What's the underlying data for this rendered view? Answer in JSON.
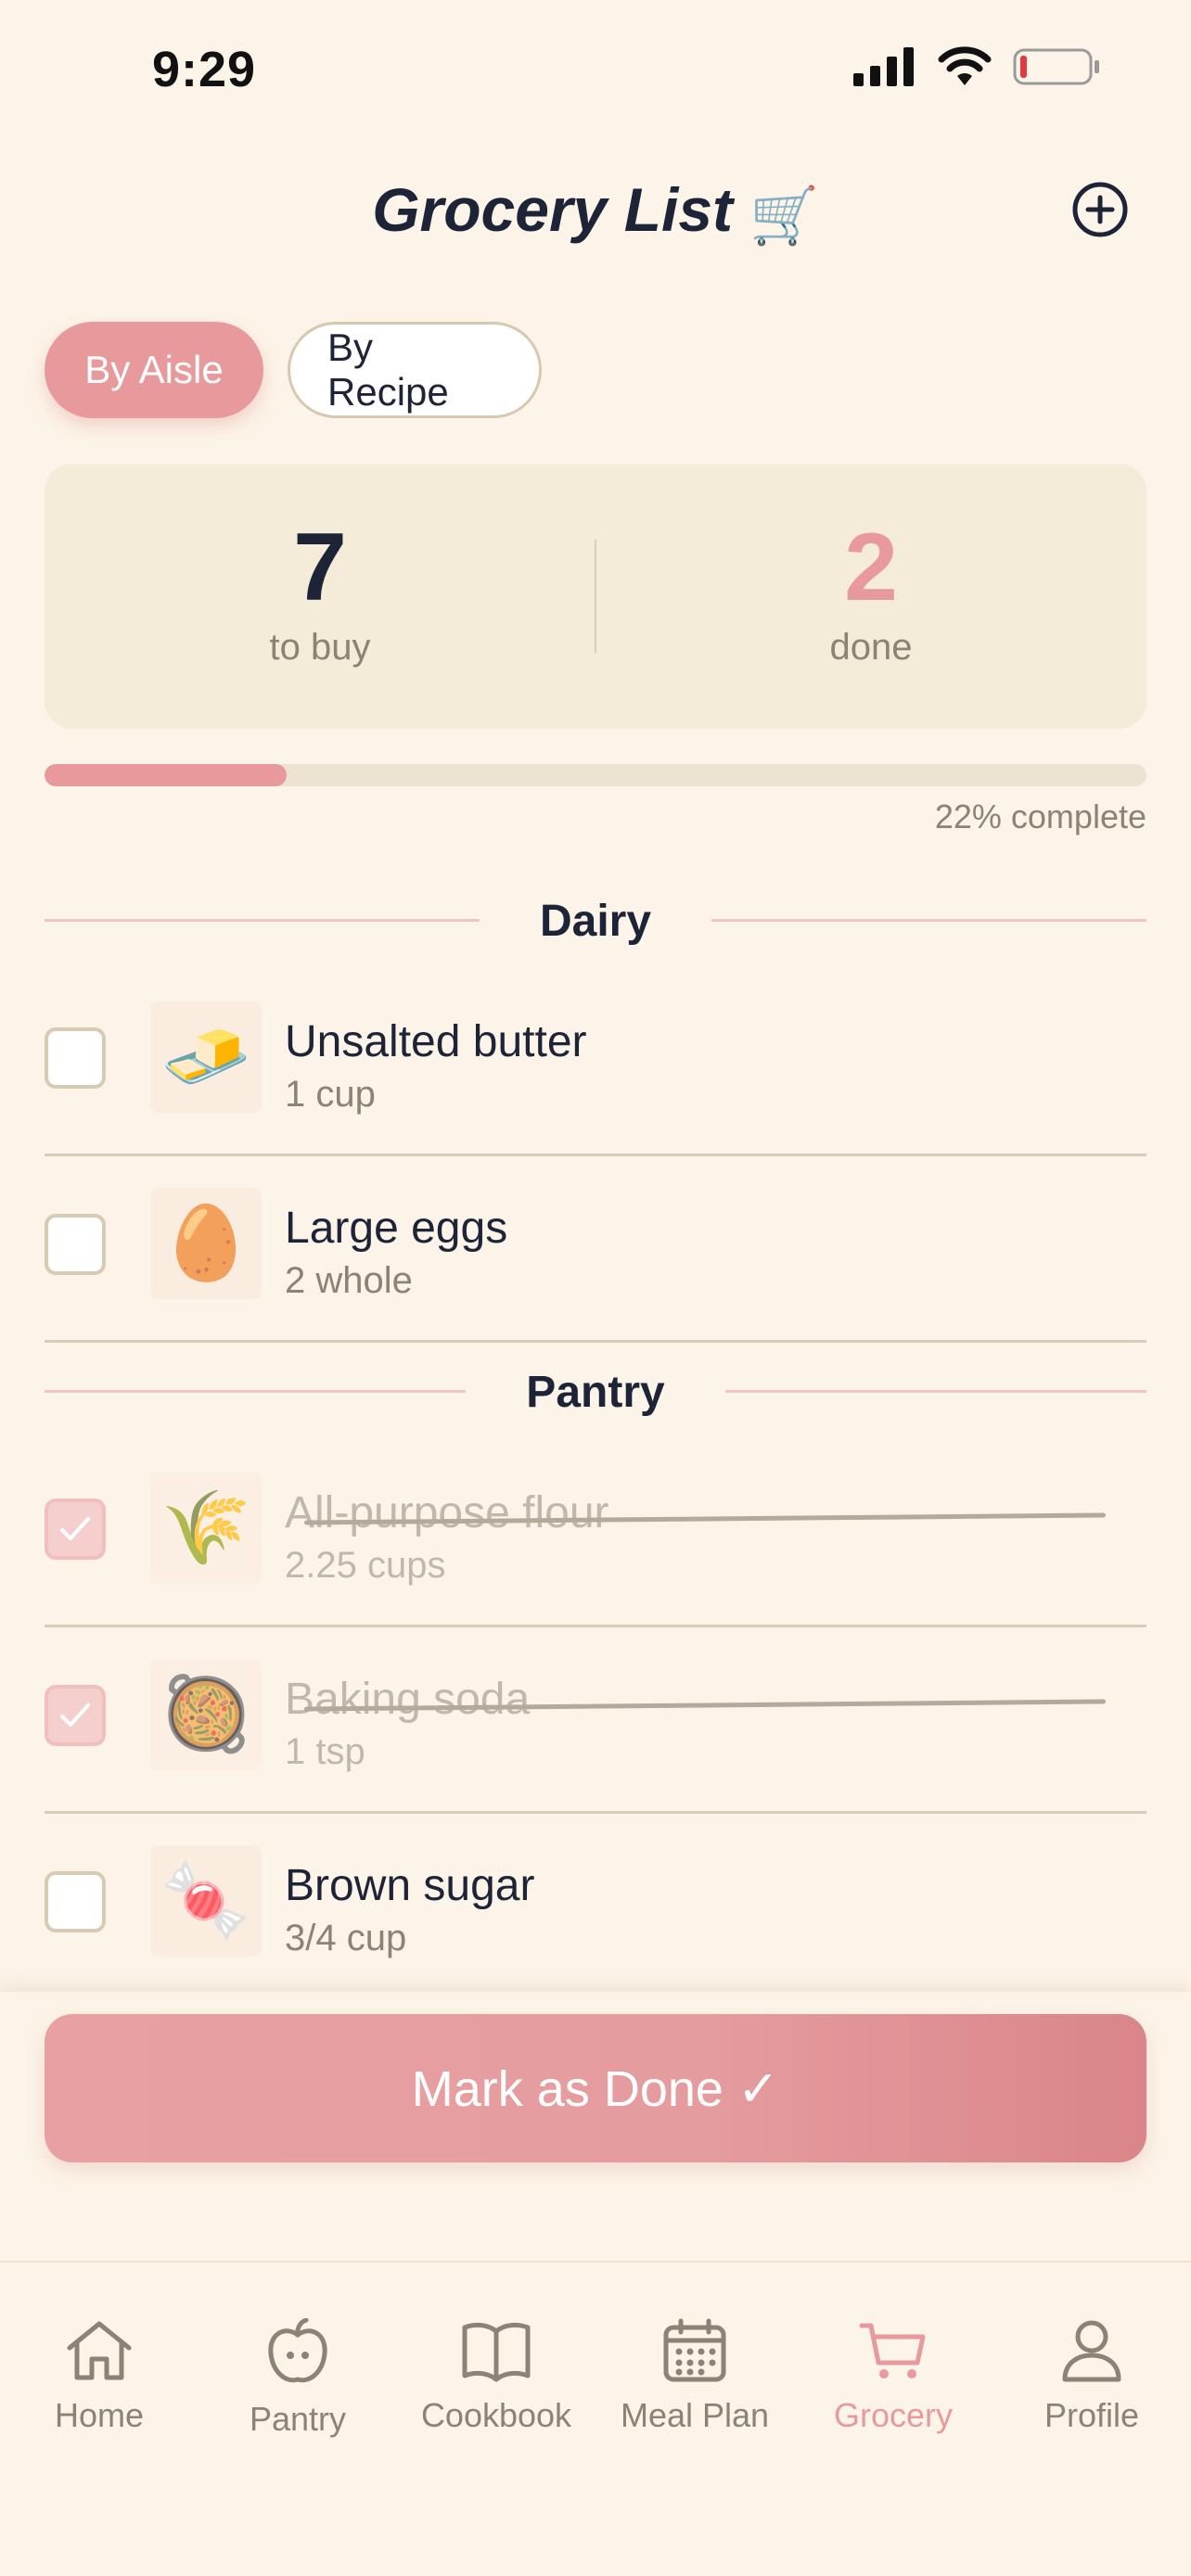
{
  "status_bar": {
    "time": "9:29"
  },
  "header": {
    "title": "Grocery List",
    "title_emoji": "🛒"
  },
  "toggle": {
    "active": "By Aisle",
    "inactive": "By Recipe"
  },
  "summary": {
    "to_buy_count": "7",
    "to_buy_label": "to buy",
    "done_count": "2",
    "done_label": "done"
  },
  "progress": {
    "fraction": 0.22,
    "label": "22% complete"
  },
  "sections": [
    {
      "title": "Dairy",
      "items": [
        {
          "name": "Unsalted butter",
          "qty": "1 cup",
          "emoji": "🧈",
          "checked": false
        },
        {
          "name": "Large eggs",
          "qty": "2 whole",
          "emoji": "🥚",
          "checked": false
        }
      ]
    },
    {
      "title": "Pantry",
      "items": [
        {
          "name": "All-purpose flour",
          "qty": "2.25 cups",
          "emoji": "🌾",
          "checked": true
        },
        {
          "name": "Baking soda",
          "qty": "1 tsp",
          "emoji": "🥘",
          "checked": true
        },
        {
          "name": "Brown sugar",
          "qty": "3/4 cup",
          "emoji": "🍬",
          "checked": false
        }
      ]
    }
  ],
  "primary_button": {
    "label": "Mark as Done ✓"
  },
  "tabs": [
    {
      "label": "Home",
      "icon": "home-icon"
    },
    {
      "label": "Pantry",
      "icon": "apple-icon"
    },
    {
      "label": "Cookbook",
      "icon": "book-icon"
    },
    {
      "label": "Meal Plan",
      "icon": "calendar-icon"
    },
    {
      "label": "Grocery",
      "icon": "cart-icon",
      "active": true
    },
    {
      "label": "Profile",
      "icon": "person-icon"
    }
  ],
  "colors": {
    "accent": "#e8999b",
    "background": "#fcf4e8",
    "text": "#1e2438",
    "muted": "#8c8275"
  }
}
